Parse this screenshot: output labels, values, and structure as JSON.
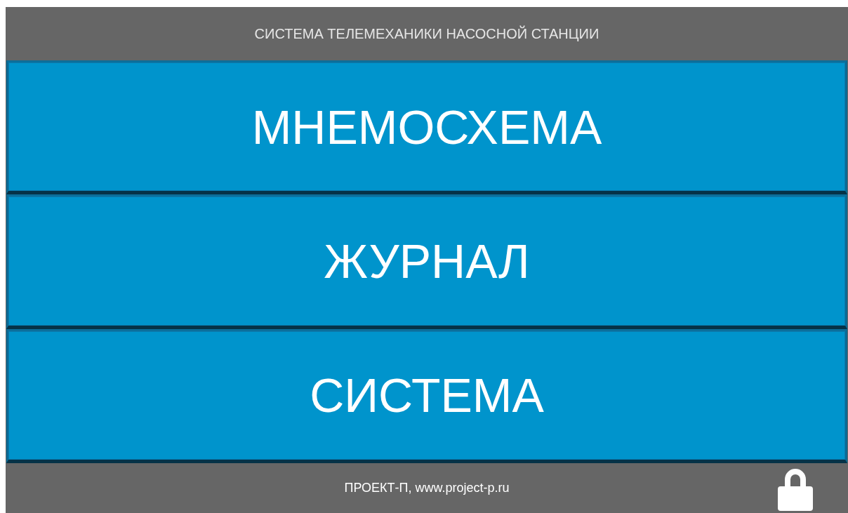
{
  "header": {
    "title": "СИСТЕМА ТЕЛЕМЕХАНИКИ НАСОСНОЙ СТАНЦИИ"
  },
  "menu": [
    {
      "label": "МНЕМОСХЕМА"
    },
    {
      "label": "ЖУРНАЛ"
    },
    {
      "label": "СИСТЕМА"
    }
  ],
  "footer": {
    "text": "ПРОЕКТ-П, www.project-p.ru"
  }
}
